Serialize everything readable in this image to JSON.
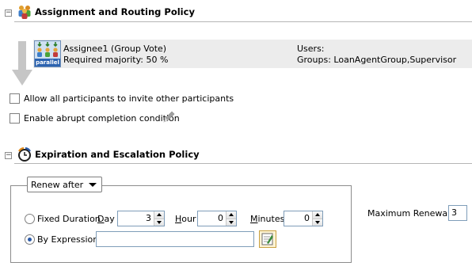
{
  "assignment": {
    "title": "Assignment and Routing Policy",
    "participant": {
      "name": "Assignee1 (Group Vote)",
      "majority": "Required majority: 50 %",
      "users": "Users:",
      "groups": "Groups: LoanAgentGroup,Supervisor",
      "badge": "parallel",
      "icon": "group-vote-icon"
    },
    "allow_invite_label": "Allow all participants to invite other participants",
    "abrupt_completion_label": "Enable abrupt completion condition"
  },
  "expiration": {
    "title": "Expiration and Escalation Policy",
    "renew_option": "Renew after",
    "fixed_duration_label": "Fixed Duration",
    "day_label": "Day",
    "day_value": "3",
    "hour_label": "Hour",
    "hour_value": "0",
    "minutes_label": "Minutes",
    "minutes_value": "0",
    "by_expression_label": "By Expression",
    "expression_value": "",
    "selected_mode": "By Expression",
    "max_renewals_label": "Maximum Renewals:",
    "max_renewals_value": "3"
  },
  "colors": {
    "accent": "#2b5aa8",
    "row_bg": "#ececec"
  }
}
